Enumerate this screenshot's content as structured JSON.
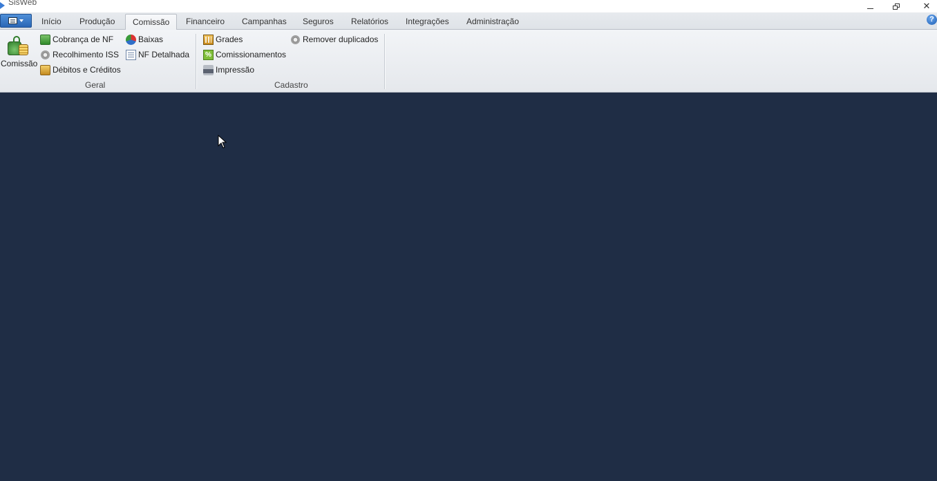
{
  "window": {
    "title": "SisWeb"
  },
  "tabs": [
    {
      "label": "Início",
      "active": false
    },
    {
      "label": "Produção",
      "active": false
    },
    {
      "label": "Comissão",
      "active": true
    },
    {
      "label": "Financeiro",
      "active": false
    },
    {
      "label": "Campanhas",
      "active": false
    },
    {
      "label": "Seguros",
      "active": false
    },
    {
      "label": "Relatórios",
      "active": false
    },
    {
      "label": "Integrações",
      "active": false
    },
    {
      "label": "Administração",
      "active": false
    }
  ],
  "ribbon": {
    "big_button": {
      "label": "Comissão",
      "icon": "money-bag-coins-icon"
    },
    "geral": {
      "label": "Geral",
      "items": [
        {
          "label": "Cobrança de NF",
          "icon": "money-icon"
        },
        {
          "label": "Recolhimento ISS",
          "icon": "gear-icon"
        },
        {
          "label": "Débitos e Créditos",
          "icon": "coins-icon"
        },
        {
          "label": "Baixas",
          "icon": "pie-chart-icon"
        },
        {
          "label": "NF Detalhada",
          "icon": "document-icon"
        }
      ]
    },
    "cadastro": {
      "label": "Cadastro",
      "items": [
        {
          "label": "Grades",
          "icon": "grid-icon"
        },
        {
          "label": "Comissionamentos",
          "icon": "percent-icon"
        },
        {
          "label": "Impressão",
          "icon": "printer-icon"
        },
        {
          "label": "Remover duplicados",
          "icon": "gear-icon"
        }
      ]
    }
  },
  "colors": {
    "workspace": "#1f2d45",
    "ribbon": "#eceef1",
    "appmenu": "#2b67b6"
  }
}
